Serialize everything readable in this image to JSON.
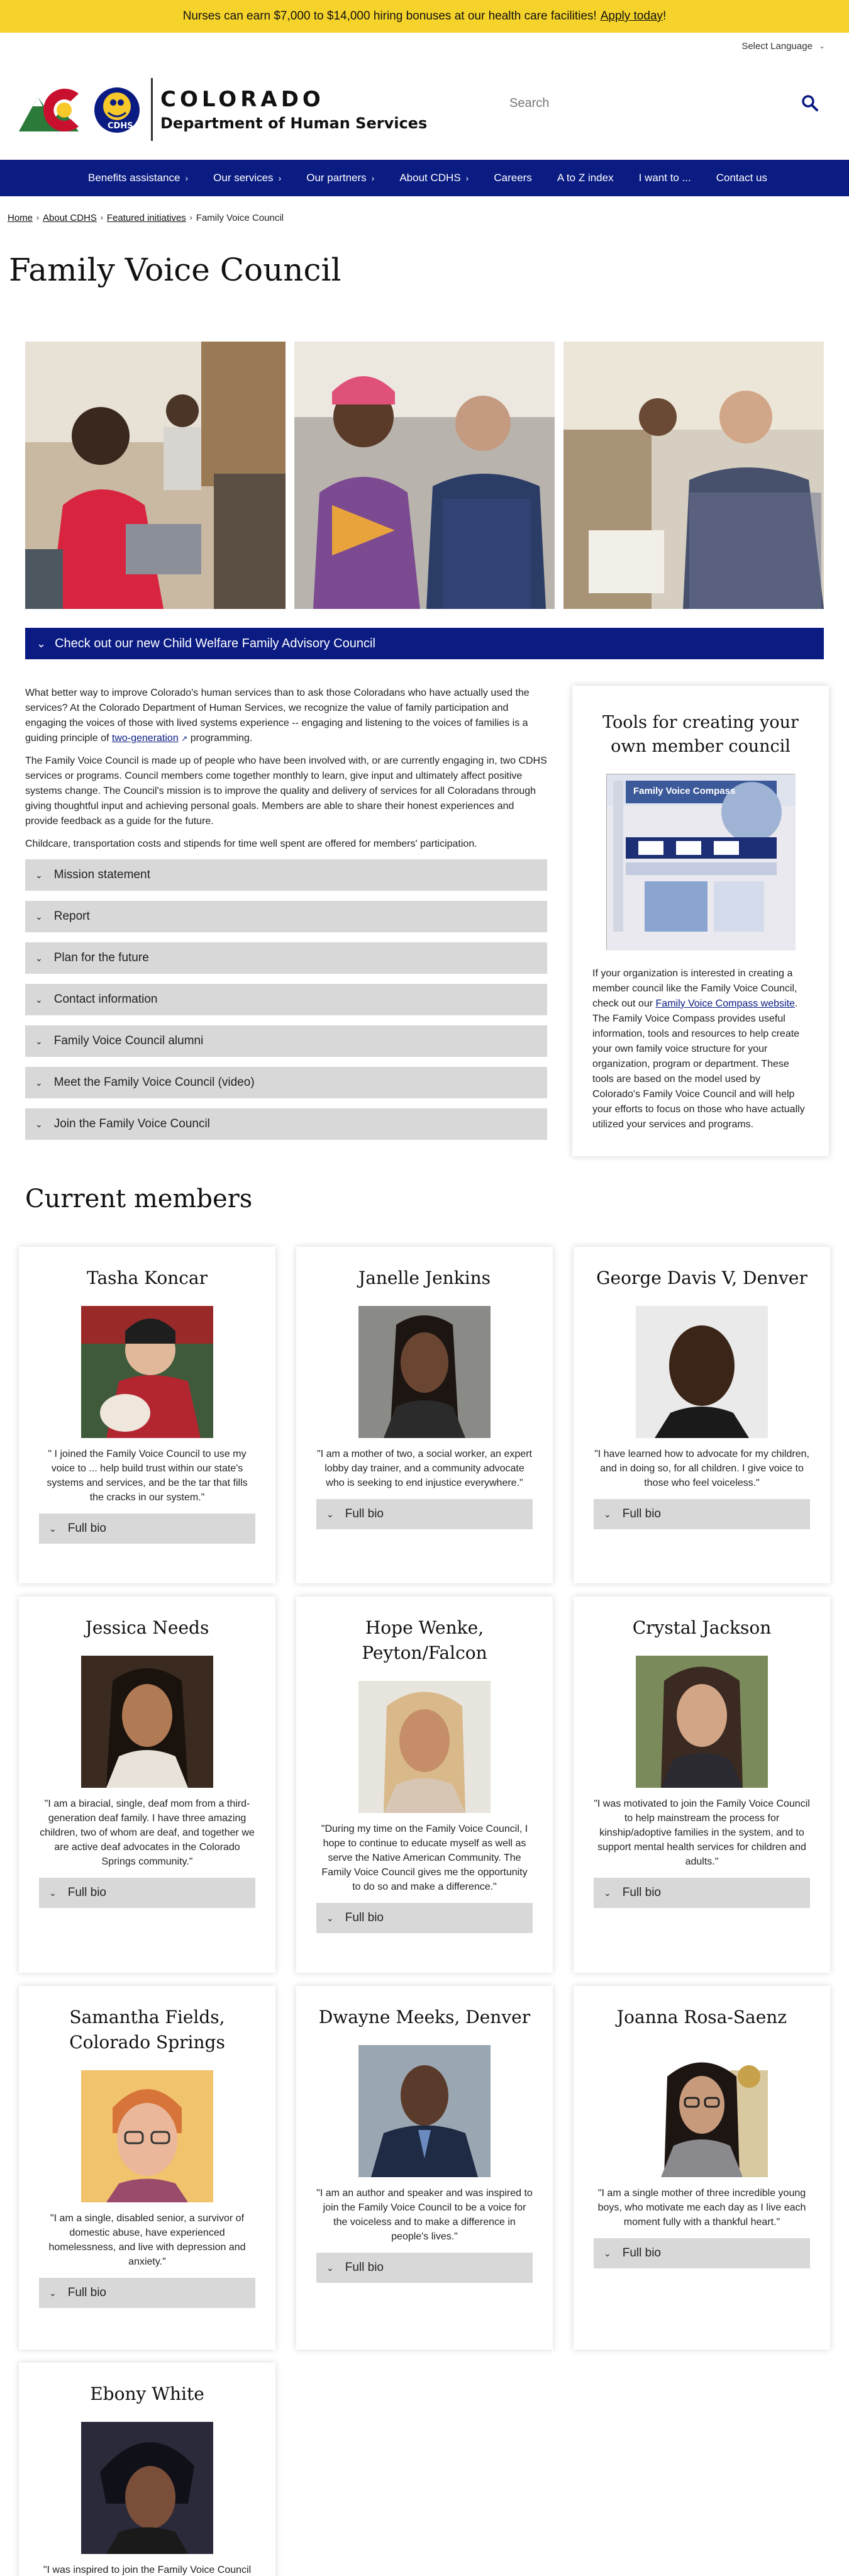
{
  "alert": {
    "text": "Nurses can earn $7,000 to $14,000 hiring bonuses at our health care facilities!",
    "link": "Apply today",
    "suffix": "!"
  },
  "language": {
    "label": "Select Language"
  },
  "brand": {
    "state": "COLORADO",
    "department": "Department of Human Services",
    "badge": "CDHS"
  },
  "search": {
    "placeholder": "Search"
  },
  "nav": {
    "items": [
      {
        "label": "Benefits assistance",
        "arrow": true
      },
      {
        "label": "Our services",
        "arrow": true
      },
      {
        "label": "Our partners",
        "arrow": true
      },
      {
        "label": "About CDHS",
        "arrow": true
      },
      {
        "label": "Careers",
        "arrow": false
      },
      {
        "label": "A to Z index",
        "arrow": false
      },
      {
        "label": "I want to ...",
        "arrow": false
      },
      {
        "label": "Contact us",
        "arrow": false
      }
    ]
  },
  "breadcrumb": {
    "items": [
      "Home",
      "About CDHS",
      "Featured initiatives"
    ],
    "current": "Family Voice Council"
  },
  "page": {
    "title": "Family Voice Council"
  },
  "banner": {
    "label": "Check out our new Child Welfare Family Advisory Council"
  },
  "intro": {
    "p1_before": "What better way to improve Colorado's human services than to ask those Coloradans who have actually used the services? At the Colorado Department of Human Services, we recognize the value of family participation and engaging the voices of those with lived systems experience -- engaging and listening to the voices of families is a guiding principle of",
    "p1_link": "two-generation",
    "p1_after": "programming.",
    "p2": "The Family Voice Council is made up of people who have been involved with, or are currently engaging in, two CDHS services or programs. Council members come together monthly to learn, give input and ultimately affect positive systems change. The Council's mission is to improve the quality and delivery of services for all Coloradans through giving thoughtful input and achieving personal goals. Members are able to share their honest experiences and provide feedback as a guide for the future.",
    "p3": "Childcare, transportation costs and stipends for time well spent are offered for members' participation."
  },
  "accordion": {
    "items": [
      "Mission statement",
      "Report",
      "Plan for the future",
      "Contact information",
      "Family Voice Council alumni",
      "Meet the Family Voice Council (video)",
      "Join the Family Voice Council"
    ]
  },
  "sidebar": {
    "title": "Tools for creating your own member council",
    "compass_title": "Family Voice Compass",
    "text_before": "If your organization is interested in creating a member council like the Family Voice Council, check out our",
    "link": "Family Voice Compass website",
    "text_after": ". The Family Voice Compass provides useful information, tools and resources to help create your own family voice structure for your organization, program or department. These tools are based on the model used by Colorado's Family Voice Council and will help your efforts to focus on those who have actually utilized your services and programs."
  },
  "members": {
    "title": "Current members",
    "bio_label": "Full bio",
    "list": [
      {
        "name": "Tasha Koncar",
        "quote": "\" I joined the Family Voice Council to use my voice to ... help build trust within our state's systems and services, and be the tar that fills the cracks in our system.\""
      },
      {
        "name": "Janelle Jenkins",
        "quote": "\"I am a mother of two, a social worker, an expert lobby day trainer, and a community advocate who is seeking to end injustice everywhere.\""
      },
      {
        "name": "George Davis V, Denver",
        "quote": "\"I have learned how to advocate for my children, and in doing so, for all children. I give voice to those who feel voiceless.\""
      },
      {
        "name": "Jessica Needs",
        "quote": "\"I am a biracial, single, deaf mom from a third-generation deaf family. I have three amazing children, two of whom are deaf, and together we are active deaf advocates in the Colorado Springs community.\""
      },
      {
        "name": "Hope Wenke, Peyton/Falcon",
        "quote": "\"During my time on the Family Voice Council, I hope to continue to educate myself as well as serve the Native American Community. The Family Voice Council gives me the opportunity to do so and make a difference.\""
      },
      {
        "name": "Crystal Jackson",
        "quote": "\"I was motivated to join the Family Voice Council to help mainstream the process for kinship/adoptive families in the system, and to support mental health services for children and adults.\""
      },
      {
        "name": "Samantha Fields, Colorado Springs",
        "quote": "\"I am a single, disabled senior, a survivor of domestic abuse, have experienced homelessness, and live with depression and anxiety.\""
      },
      {
        "name": "Dwayne Meeks, Denver",
        "quote": "\"I am an author and speaker and was inspired to join the Family Voice Council to be a voice for the voiceless and to make a difference in people's lives.\""
      },
      {
        "name": "Joanna Rosa-Saenz",
        "quote": "\"I am a single mother of three incredible young boys, who motivate me each day as I live each moment fully with a thankful heart.\""
      },
      {
        "name": "Ebony White",
        "quote": "\"I was inspired to join the Family Voice Council"
      }
    ]
  }
}
